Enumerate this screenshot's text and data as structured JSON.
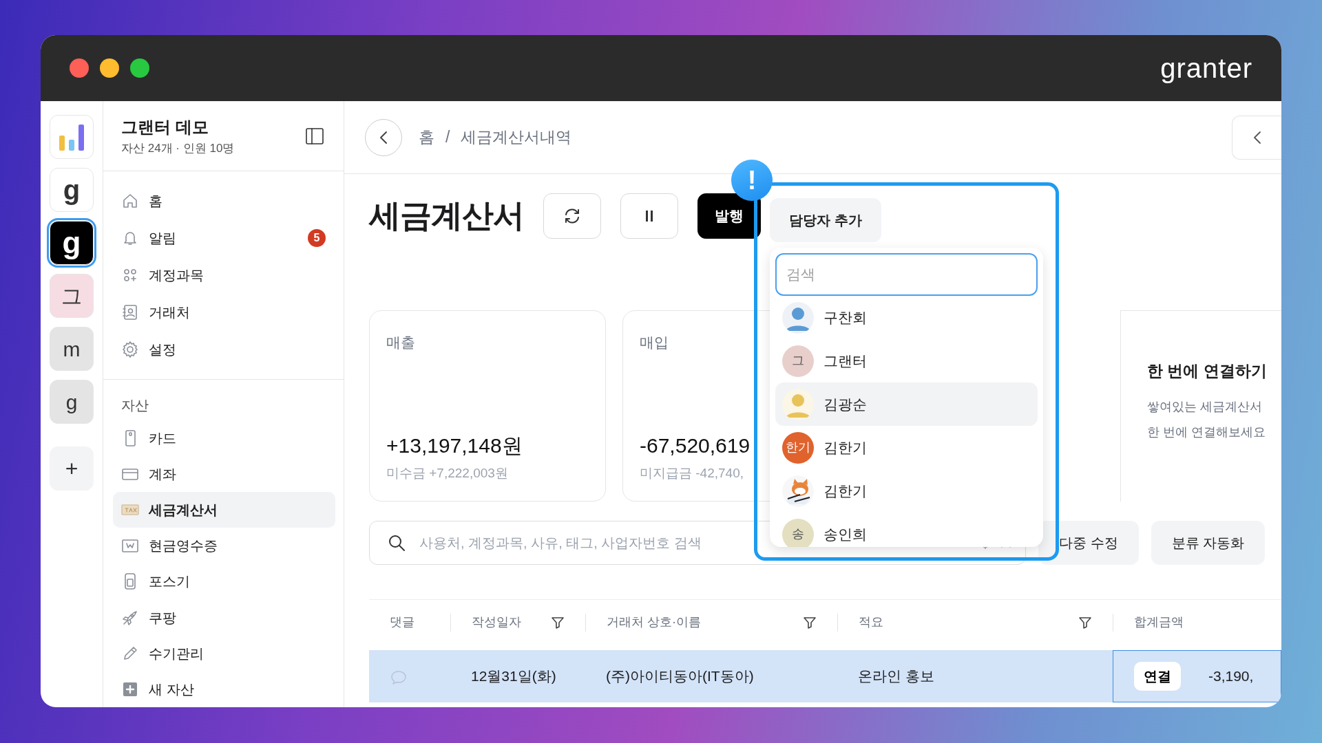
{
  "window": {
    "logo": "granter"
  },
  "rail": [
    {
      "kind": "chart",
      "selected": false
    },
    {
      "kind": "letter",
      "label": "g",
      "color": "#ffffff",
      "selected": false
    },
    {
      "kind": "letter",
      "label": "g",
      "color": "#000000",
      "selected": true
    },
    {
      "kind": "letter",
      "label": "그",
      "color": "#f6dde3",
      "selected": false
    },
    {
      "kind": "letter",
      "label": "m",
      "color": "#e4e4e4",
      "selected": false
    },
    {
      "kind": "letter",
      "label": "g",
      "color": "#e4e4e4",
      "selected": false
    },
    {
      "kind": "add",
      "label": "+",
      "selected": false
    }
  ],
  "sidebar": {
    "title": "그랜터 데모",
    "subtitle": "자산 24개 · 인원 10명",
    "nav": [
      {
        "label": "홈",
        "selected": false
      },
      {
        "label": "알림",
        "badge": "5",
        "selected": false
      },
      {
        "label": "계정과목",
        "selected": false
      },
      {
        "label": "거래처",
        "selected": false
      },
      {
        "label": "설정",
        "selected": false
      }
    ],
    "section": "자산",
    "assets": [
      {
        "label": "카드",
        "selected": false
      },
      {
        "label": "계좌",
        "selected": false
      },
      {
        "label": "세금계산서",
        "selected": true
      },
      {
        "label": "현금영수증",
        "selected": false
      },
      {
        "label": "포스기",
        "selected": false
      },
      {
        "label": "쿠팡",
        "selected": false
      },
      {
        "label": "수기관리",
        "selected": false
      },
      {
        "label": "새 자산",
        "selected": false
      }
    ]
  },
  "breadcrumb": {
    "items": [
      "홈",
      "세금계산서내역"
    ],
    "separator": "/"
  },
  "page": {
    "title": "세금계산서",
    "buttons": [
      {
        "kind": "refresh"
      },
      {
        "kind": "pause"
      },
      {
        "kind": "primary",
        "label": "발행"
      }
    ]
  },
  "summary": [
    {
      "label": "매출",
      "amount": "+13,197,148원",
      "sub": "미수금 +7,222,003원"
    },
    {
      "label": "매입",
      "amount": "-67,520,619",
      "sub": "미지급금 -42,740,"
    }
  ],
  "promo": {
    "title": "한 번에 연결하기",
    "lines": [
      "쌓여있는 세금계산서",
      "한 번에 연결해보세요"
    ]
  },
  "search": {
    "placeholder": "사용처, 계정과목, 사유, 태그, 사업자번호 검색"
  },
  "actions": [
    "다중 수정",
    "분류 자동화"
  ],
  "table": {
    "columns": [
      {
        "label": "댓글",
        "filter": false
      },
      {
        "label": "작성일자",
        "filter": true
      },
      {
        "label": "거래처 상호·이름",
        "filter": true
      },
      {
        "label": "적요",
        "filter": true
      },
      {
        "label": "합계금액",
        "filter": false
      }
    ],
    "rows": [
      {
        "date": "12월31일(화)",
        "vendor": "(주)아이티동아(IT동아)",
        "memo": "온라인 홍보",
        "action": "연결",
        "total": "-3,190,",
        "selected": true
      }
    ]
  },
  "popup": {
    "alert": "!",
    "button": "담당자 추가",
    "search": {
      "placeholder": "검색"
    },
    "people": [
      {
        "kind": "silhouette",
        "name": "구찬회",
        "color": "#5b9bd5",
        "selected": false
      },
      {
        "kind": "initial",
        "initial": "그",
        "name": "그랜터",
        "color": "#e8cfcc",
        "selected": false
      },
      {
        "kind": "silhouette",
        "name": "김광순",
        "color": "#e8c35a",
        "selected": true
      },
      {
        "kind": "initial",
        "initial": "한기",
        "name": "김한기",
        "color": "#e0622d",
        "selected": false
      },
      {
        "kind": "picture",
        "name": "김한기",
        "selected": false
      },
      {
        "kind": "initial",
        "initial": "송",
        "name": "송인희",
        "color": "#e3dfc0",
        "selected": false
      }
    ]
  }
}
